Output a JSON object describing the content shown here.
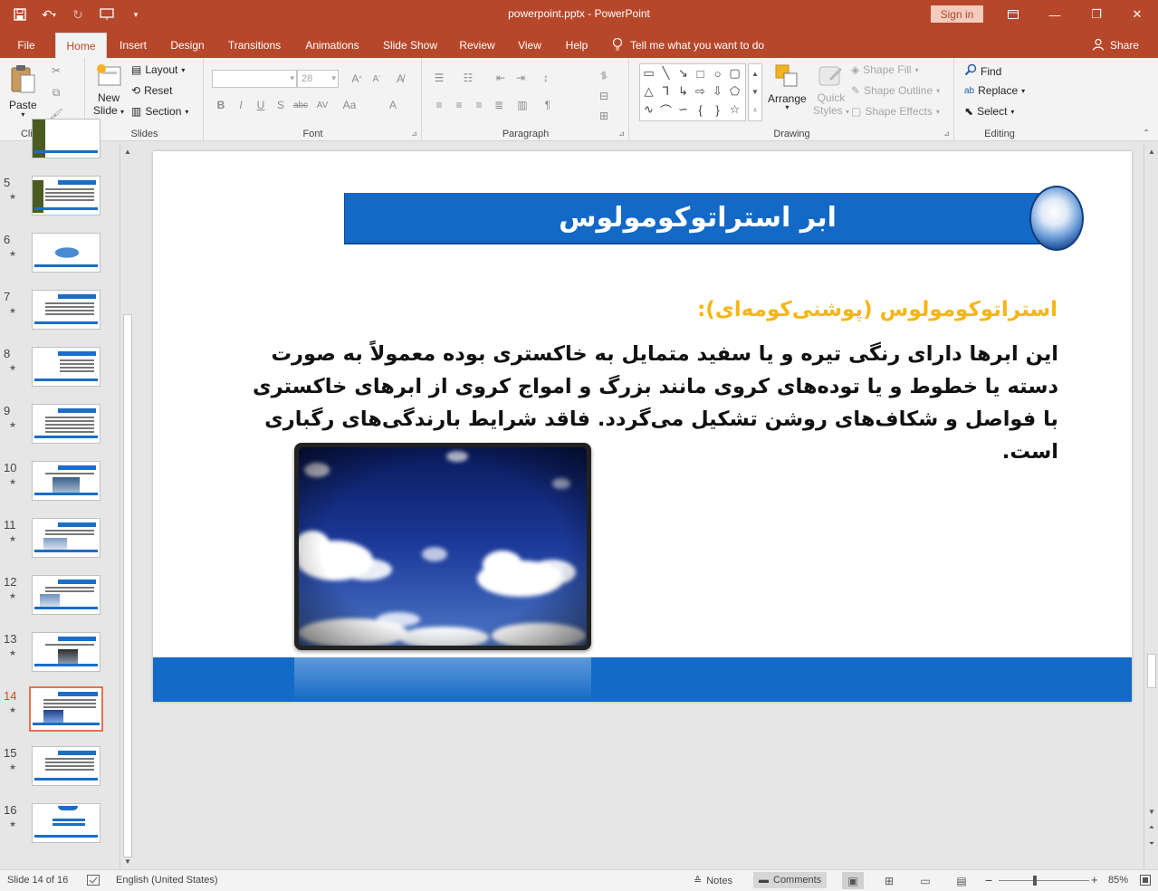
{
  "window": {
    "doc_title": "powerpoint.pptx  -  PowerPoint",
    "signin": "Sign in"
  },
  "tabs": [
    {
      "label": "File"
    },
    {
      "label": "Home"
    },
    {
      "label": "Insert"
    },
    {
      "label": "Design"
    },
    {
      "label": "Transitions"
    },
    {
      "label": "Animations"
    },
    {
      "label": "Slide Show"
    },
    {
      "label": "Review"
    },
    {
      "label": "View"
    },
    {
      "label": "Help"
    }
  ],
  "tellme": "Tell me what you want to do",
  "share": "Share",
  "ribbon": {
    "clipboard": {
      "label": "Clipboard",
      "paste": "Paste"
    },
    "slides": {
      "label": "Slides",
      "new_slide_1": "New",
      "new_slide_2": "Slide",
      "layout": "Layout",
      "reset": "Reset",
      "section": "Section"
    },
    "font": {
      "label": "Font",
      "font_name": "",
      "font_size": "28"
    },
    "paragraph": {
      "label": "Paragraph"
    },
    "drawing": {
      "label": "Drawing",
      "arrange": "Arrange",
      "quick_styles_1": "Quick",
      "quick_styles_2": "Styles",
      "shape_fill": "Shape Fill",
      "shape_outline": "Shape Outline",
      "shape_effects": "Shape Effects"
    },
    "editing": {
      "label": "Editing",
      "find": "Find",
      "replace": "Replace",
      "select": "Select"
    }
  },
  "thumbnails": [
    {
      "num": "5"
    },
    {
      "num": "6"
    },
    {
      "num": "7"
    },
    {
      "num": "8"
    },
    {
      "num": "9"
    },
    {
      "num": "10"
    },
    {
      "num": "11"
    },
    {
      "num": "12"
    },
    {
      "num": "13"
    },
    {
      "num": "14"
    },
    {
      "num": "15"
    },
    {
      "num": "16"
    }
  ],
  "slide": {
    "title": "ابر استراتوکومولوس",
    "subtitle": "استراتوکومولوس (پوشنی‌کومه‌ای):",
    "body": "این ابرها دارای رنگی تیره و یا سفید متمایل به خاکستری بوده معمولاً به صورت دسته یا خطوط و یا توده‌های کروی مانند بزرگ و امواج کروی از ابرهای خاکستری با فواصل و شکاف‌های روشن تشکیل می‌گردد. فاقد شرایط بارندگی‌های رگباری است."
  },
  "status": {
    "slide_info": "Slide 14 of 16",
    "language": "English (United States)",
    "notes": "Notes",
    "comments": "Comments",
    "zoom": "85%"
  },
  "colors": {
    "app_accent": "#b7472a",
    "slide_title_bar": "#1469c7",
    "slide_subtitle": "#f5b617",
    "slide_footer": "#136ac7"
  }
}
